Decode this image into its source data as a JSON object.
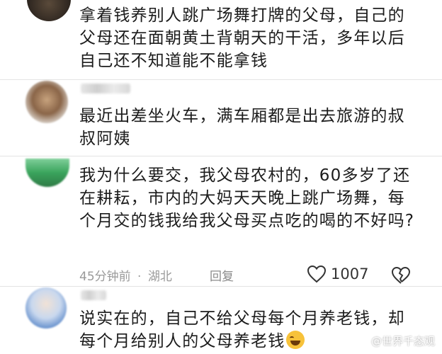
{
  "comments": [
    {
      "avatar_icon": "blurred-avatar-dark",
      "text": "拿着钱养别人跳广场舞打牌的父母，自己的父母还在面朝黄土背朝天的干活，多年以后自己还不知道能不能拿钱"
    },
    {
      "avatar_icon": "blurred-avatar-brown",
      "text": "最近出差坐火车，满车厢都是出去旅游的叔叔阿姨"
    },
    {
      "avatar_icon": "blurred-avatar-green",
      "text": "我为什么要交，我父母农村的，60多岁了还在耕耘，市内的大妈天天晚上跳广场舞，每个月交的钱我给我父母买点吃的喝的不好吗?",
      "time": "45分钟前",
      "separator": "·",
      "location": "湖北",
      "reply_label": "回复",
      "like_count": "1007",
      "like_icon": "heart-outline-icon",
      "dislike_icon": "broken-heart-icon"
    },
    {
      "avatar_icon": "blurred-avatar-blue",
      "text": "说实在的，自己不给父母每个月养老钱，却每个月给别人的父母养老钱",
      "emoji": "laughing-emoji"
    }
  ],
  "watermark": "@世界千态观",
  "colors": {
    "text": "#1c1c1c",
    "meta": "#9a9a9a",
    "divider": "#e4e4e4"
  }
}
